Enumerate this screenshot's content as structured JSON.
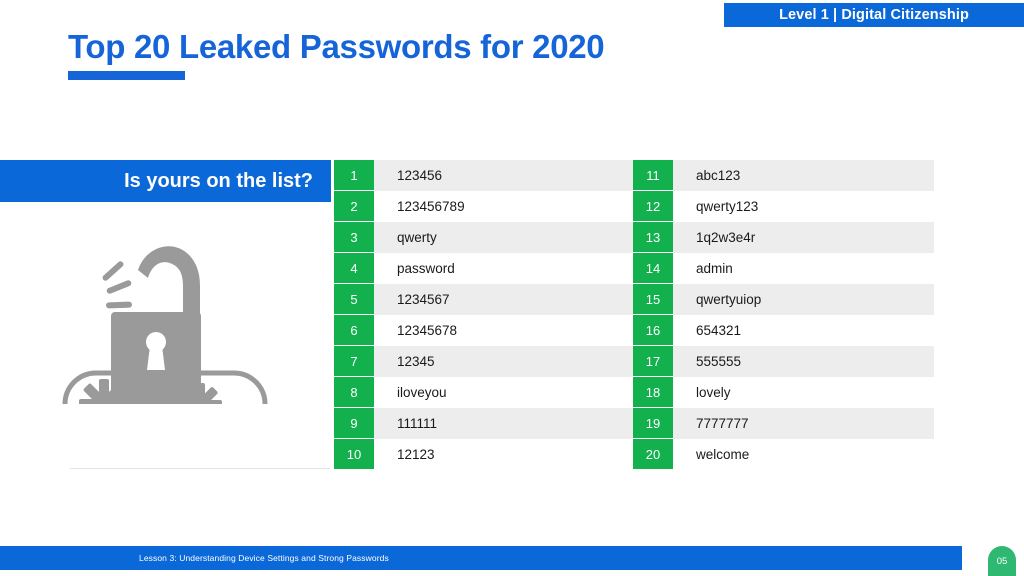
{
  "header": {
    "level_tag": "Level 1 | Digital Citizenship"
  },
  "title": {
    "text": "Top 20 Leaked Passwords for 2020"
  },
  "banner": {
    "text": "Is yours on the list?"
  },
  "illustration": {
    "name": "open-padlock-with-password-field",
    "asterisks": "✳ ✳ ✳"
  },
  "table": {
    "left_column": [
      {
        "rank": "1",
        "password": "123456"
      },
      {
        "rank": "2",
        "password": "123456789"
      },
      {
        "rank": "3",
        "password": "qwerty"
      },
      {
        "rank": "4",
        "password": "password"
      },
      {
        "rank": "5",
        "password": "1234567"
      },
      {
        "rank": "6",
        "password": "12345678"
      },
      {
        "rank": "7",
        "password": "12345"
      },
      {
        "rank": "8",
        "password": "iloveyou"
      },
      {
        "rank": "9",
        "password": "111111"
      },
      {
        "rank": "10",
        "password": "12123"
      }
    ],
    "right_column": [
      {
        "rank": "11",
        "password": "abc123"
      },
      {
        "rank": "12",
        "password": "qwerty123"
      },
      {
        "rank": "13",
        "password": "1q2w3e4r"
      },
      {
        "rank": "14",
        "password": "admin"
      },
      {
        "rank": "15",
        "password": "qwertyuiop"
      },
      {
        "rank": "16",
        "password": "654321"
      },
      {
        "rank": "17",
        "password": "555555"
      },
      {
        "rank": "18",
        "password": "lovely"
      },
      {
        "rank": "19",
        "password": "7777777"
      },
      {
        "rank": "20",
        "password": "welcome"
      }
    ]
  },
  "footer": {
    "lesson_text": "Lesson 3: Understanding Device Settings and Strong Passwords",
    "page_number": "05"
  },
  "colors": {
    "blue": "#0b68d8",
    "title_blue": "#1565d8",
    "green": "#12b14d",
    "badge_green": "#2eb872",
    "row_gray": "#ededed"
  }
}
